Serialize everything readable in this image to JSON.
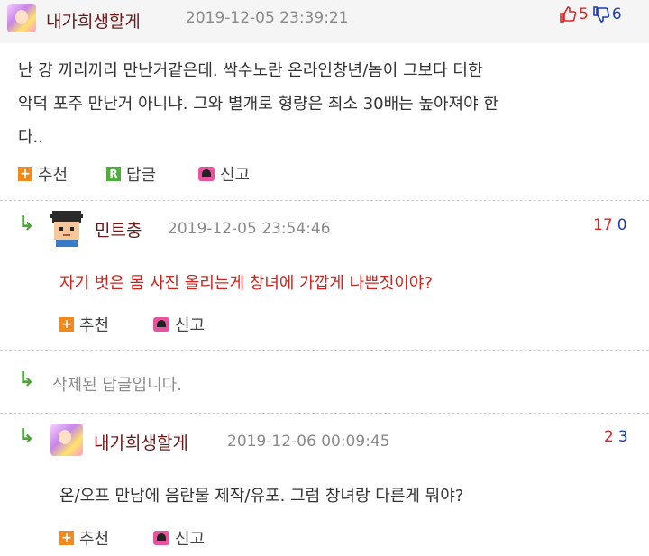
{
  "top_comment": {
    "nickname": "내가희생할게",
    "timestamp": "2019-12-05 23:39:21",
    "likes": "5",
    "dislikes": "6",
    "body_line1": "난 걍 끼리끼리 만난거같은데. 싹수노란 온라인창년/놈이 그보다 더한",
    "body_line2": "악덕 포주 만난거 아니냐. 그와 별개로 형량은 최소 30배는 높아져야 한",
    "body_line3": "다..",
    "recommend_label": "추천",
    "reply_label": "답글",
    "report_label": "신고"
  },
  "reply1": {
    "nickname": "민트충",
    "timestamp": "2019-12-05 23:54:46",
    "likes": "17",
    "dislikes": "0",
    "text": "자기 벗은 몸 사진 올리는게 창녀에 가깝게 나쁜짓이야?",
    "recommend_label": "추천",
    "report_label": "신고"
  },
  "deleted_reply": {
    "text": "삭제된 답글입니다."
  },
  "reply2": {
    "nickname": "내가희생할게",
    "timestamp": "2019-12-06 00:09:45",
    "likes": "2",
    "dislikes": "3",
    "text": "온/오프 만남에 음란물 제작/유포. 그럼 창녀랑 다른게 뭐야?",
    "recommend_label": "추천",
    "report_label": "신고"
  },
  "colors": {
    "like": "#e02424",
    "dislike": "#1c3cb8",
    "reply_arrow": "#4ba33a",
    "highlight_text": "#d0241e"
  }
}
